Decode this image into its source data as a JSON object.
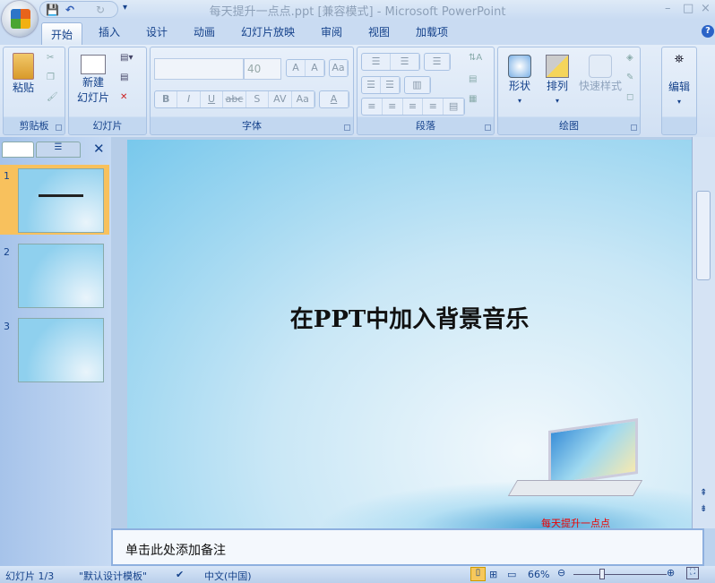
{
  "window": {
    "title": "每天提升一点点.ppt [兼容模式] - Microsoft PowerPoint",
    "minimize": "–",
    "maximize": "□",
    "close": "×"
  },
  "qat": {
    "save": "💾",
    "undo": "↶",
    "redo": "↻",
    "more": "▾"
  },
  "tabs": [
    "开始",
    "插入",
    "设计",
    "动画",
    "幻灯片放映",
    "审阅",
    "视图",
    "加载项"
  ],
  "help": "?",
  "ribbon": {
    "clipboard": {
      "label": "剪贴板",
      "paste": "粘贴"
    },
    "slides": {
      "label": "幻灯片",
      "new_slide_1": "新建",
      "new_slide_2": "幻灯片"
    },
    "font": {
      "label": "字体",
      "font_name": "",
      "font_size": "40",
      "grow": "A",
      "shrink": "A",
      "clear": "Aa",
      "bold": "B",
      "italic": "I",
      "underline": "U",
      "strike": "abc",
      "shadow": "S",
      "spacing": "AV",
      "case": "Aa",
      "color": "A"
    },
    "paragraph": {
      "label": "段落"
    },
    "drawing": {
      "label": "绘图",
      "shapes": "形状",
      "arrange": "排列",
      "quick_styles": "快速样式"
    },
    "editing": {
      "label": "编辑"
    }
  },
  "slides": [
    {
      "number": "1",
      "selected": true
    },
    {
      "number": "2"
    },
    {
      "number": "3"
    }
  ],
  "slide": {
    "title": "在PPT中加入背景音乐",
    "footer_text": "每天提升一点点"
  },
  "notes": {
    "placeholder": "单击此处添加备注"
  },
  "status": {
    "slide": "幻灯片 1/3",
    "theme": "\"默认设计模板\"",
    "language": "中文(中国)",
    "zoom": "66%"
  },
  "colors": {
    "accent": "#f4b54a",
    "ribbon": "#d1e0f3",
    "footer": "#ee0000"
  }
}
